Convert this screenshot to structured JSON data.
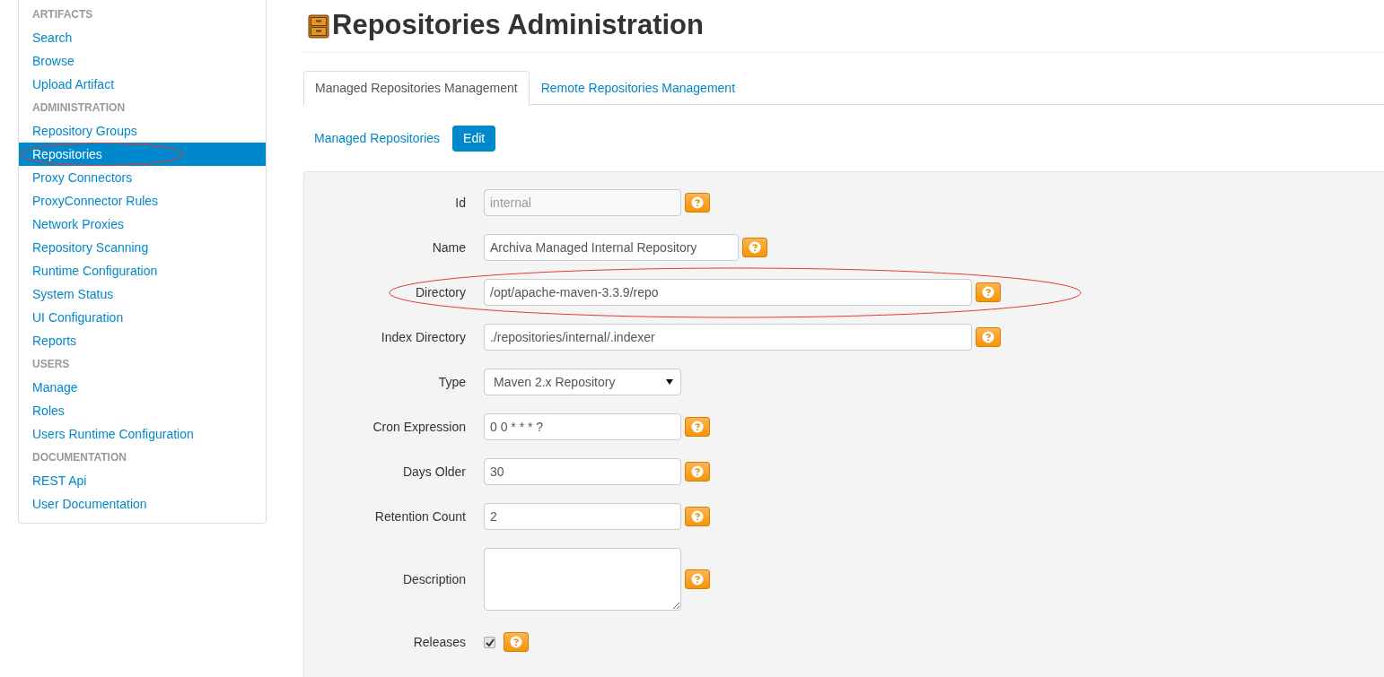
{
  "sidebar": {
    "items": [
      {
        "kind": "header",
        "label": "ARTIFACTS"
      },
      {
        "kind": "link",
        "label": "Search",
        "selected": false,
        "circled": false
      },
      {
        "kind": "link",
        "label": "Browse",
        "selected": false,
        "circled": false
      },
      {
        "kind": "link",
        "label": "Upload Artifact",
        "selected": false,
        "circled": false
      },
      {
        "kind": "header",
        "label": "ADMINISTRATION"
      },
      {
        "kind": "link",
        "label": "Repository Groups",
        "selected": false,
        "circled": false
      },
      {
        "kind": "link",
        "label": "Repositories",
        "selected": true,
        "circled": true
      },
      {
        "kind": "link",
        "label": "Proxy Connectors",
        "selected": false,
        "circled": false
      },
      {
        "kind": "link",
        "label": "ProxyConnector Rules",
        "selected": false,
        "circled": false
      },
      {
        "kind": "link",
        "label": "Network Proxies",
        "selected": false,
        "circled": false
      },
      {
        "kind": "link",
        "label": "Repository Scanning",
        "selected": false,
        "circled": false
      },
      {
        "kind": "link",
        "label": "Runtime Configuration",
        "selected": false,
        "circled": false
      },
      {
        "kind": "link",
        "label": "System Status",
        "selected": false,
        "circled": false
      },
      {
        "kind": "link",
        "label": "UI Configuration",
        "selected": false,
        "circled": false
      },
      {
        "kind": "link",
        "label": "Reports",
        "selected": false,
        "circled": false
      },
      {
        "kind": "header",
        "label": "USERS"
      },
      {
        "kind": "link",
        "label": "Manage",
        "selected": false,
        "circled": false
      },
      {
        "kind": "link",
        "label": "Roles",
        "selected": false,
        "circled": false
      },
      {
        "kind": "link",
        "label": "Users Runtime Configuration",
        "selected": false,
        "circled": false
      },
      {
        "kind": "header",
        "label": "DOCUMENTATION"
      },
      {
        "kind": "link",
        "label": "REST Api",
        "selected": false,
        "circled": false
      },
      {
        "kind": "link",
        "label": "User Documentation",
        "selected": false,
        "circled": false
      }
    ]
  },
  "page": {
    "title": "Repositories Administration"
  },
  "tabs": [
    {
      "label": "Managed Repositories Management",
      "selected": true
    },
    {
      "label": "Remote Repositories Management",
      "selected": false
    }
  ],
  "subnav": [
    {
      "label": "Managed Repositories",
      "selected": false
    },
    {
      "label": "Edit",
      "selected": true
    }
  ],
  "form": {
    "fields": [
      {
        "kind": "short",
        "label": "Id",
        "value": "internal",
        "disabled": true,
        "circled": false
      },
      {
        "kind": "medium",
        "label": "Name",
        "value": "Archiva Managed Internal Repository",
        "disabled": false,
        "circled": false
      },
      {
        "kind": "long",
        "label": "Directory",
        "value": "/opt/apache-maven-3.3.9/repo",
        "disabled": false,
        "circled": true
      },
      {
        "kind": "long",
        "label": "Index Directory",
        "value": "./repositories/internal/.indexer",
        "disabled": false,
        "circled": false
      },
      {
        "kind": "select",
        "label": "Type",
        "value": "Maven 2.x Repository"
      },
      {
        "kind": "short",
        "label": "Cron Expression",
        "value": "0 0 * * * ?",
        "disabled": false,
        "circled": false
      },
      {
        "kind": "short",
        "label": "Days Older",
        "value": "30",
        "disabled": false,
        "circled": false
      },
      {
        "kind": "short",
        "label": "Retention Count",
        "value": "2",
        "disabled": false,
        "circled": false
      },
      {
        "kind": "textarea",
        "label": "Description"
      },
      {
        "kind": "checkbox",
        "label": "Releases",
        "checked": true
      }
    ]
  }
}
